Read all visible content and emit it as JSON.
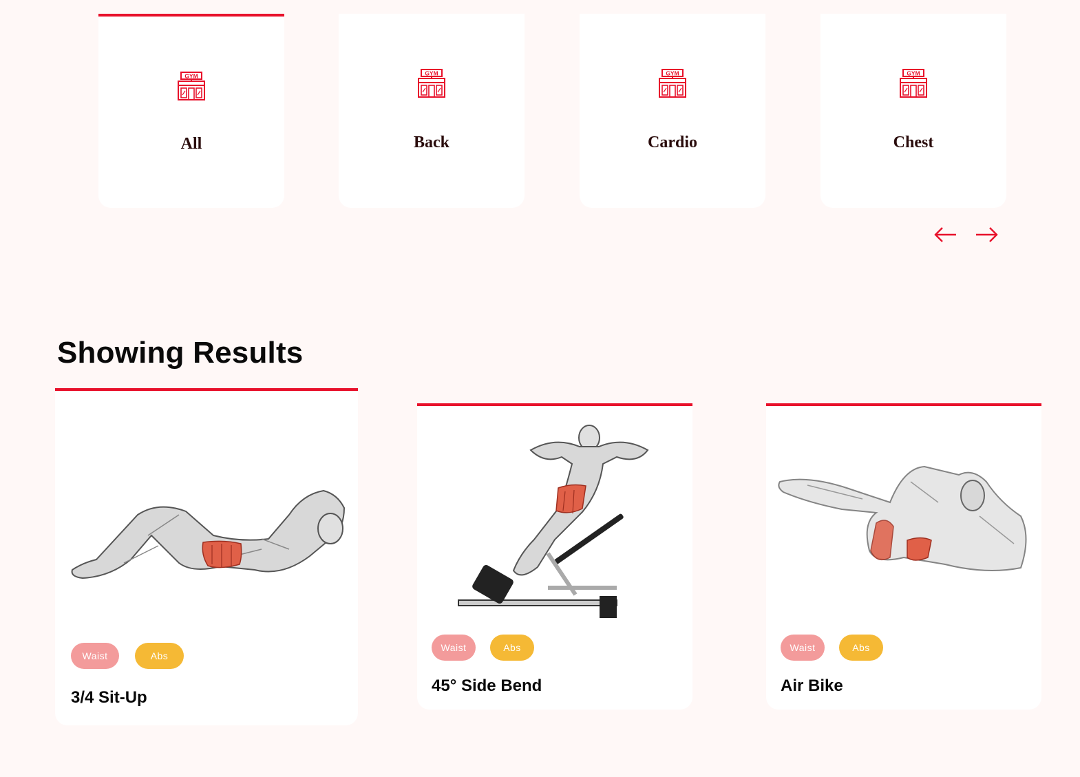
{
  "categories": [
    {
      "label": "All",
      "icon": "gym-building-icon",
      "icon_text": "GYM",
      "active": true
    },
    {
      "label": "Back",
      "icon": "gym-building-icon",
      "icon_text": "GYM",
      "active": false
    },
    {
      "label": "Cardio",
      "icon": "gym-building-icon",
      "icon_text": "GYM",
      "active": false
    },
    {
      "label": "Chest",
      "icon": "gym-building-icon",
      "icon_text": "GYM",
      "active": false
    }
  ],
  "carousel": {
    "prev_icon": "arrow-left-icon",
    "next_icon": "arrow-right-icon"
  },
  "results": {
    "title": "Showing Results",
    "exercises": [
      {
        "name": "3/4 Sit-Up",
        "tags": [
          "Waist",
          "Abs"
        ],
        "image": "sit-up-illustration"
      },
      {
        "name": "45° Side Bend",
        "tags": [
          "Waist",
          "Abs"
        ],
        "image": "side-bend-illustration"
      },
      {
        "name": "Air Bike",
        "tags": [
          "Waist",
          "Abs"
        ],
        "image": "air-bike-illustration"
      }
    ]
  },
  "colors": {
    "accent": "#e8112b",
    "background": "#fff8f7",
    "tag_waist": "#f39b9b",
    "tag_abs": "#f5b935"
  }
}
